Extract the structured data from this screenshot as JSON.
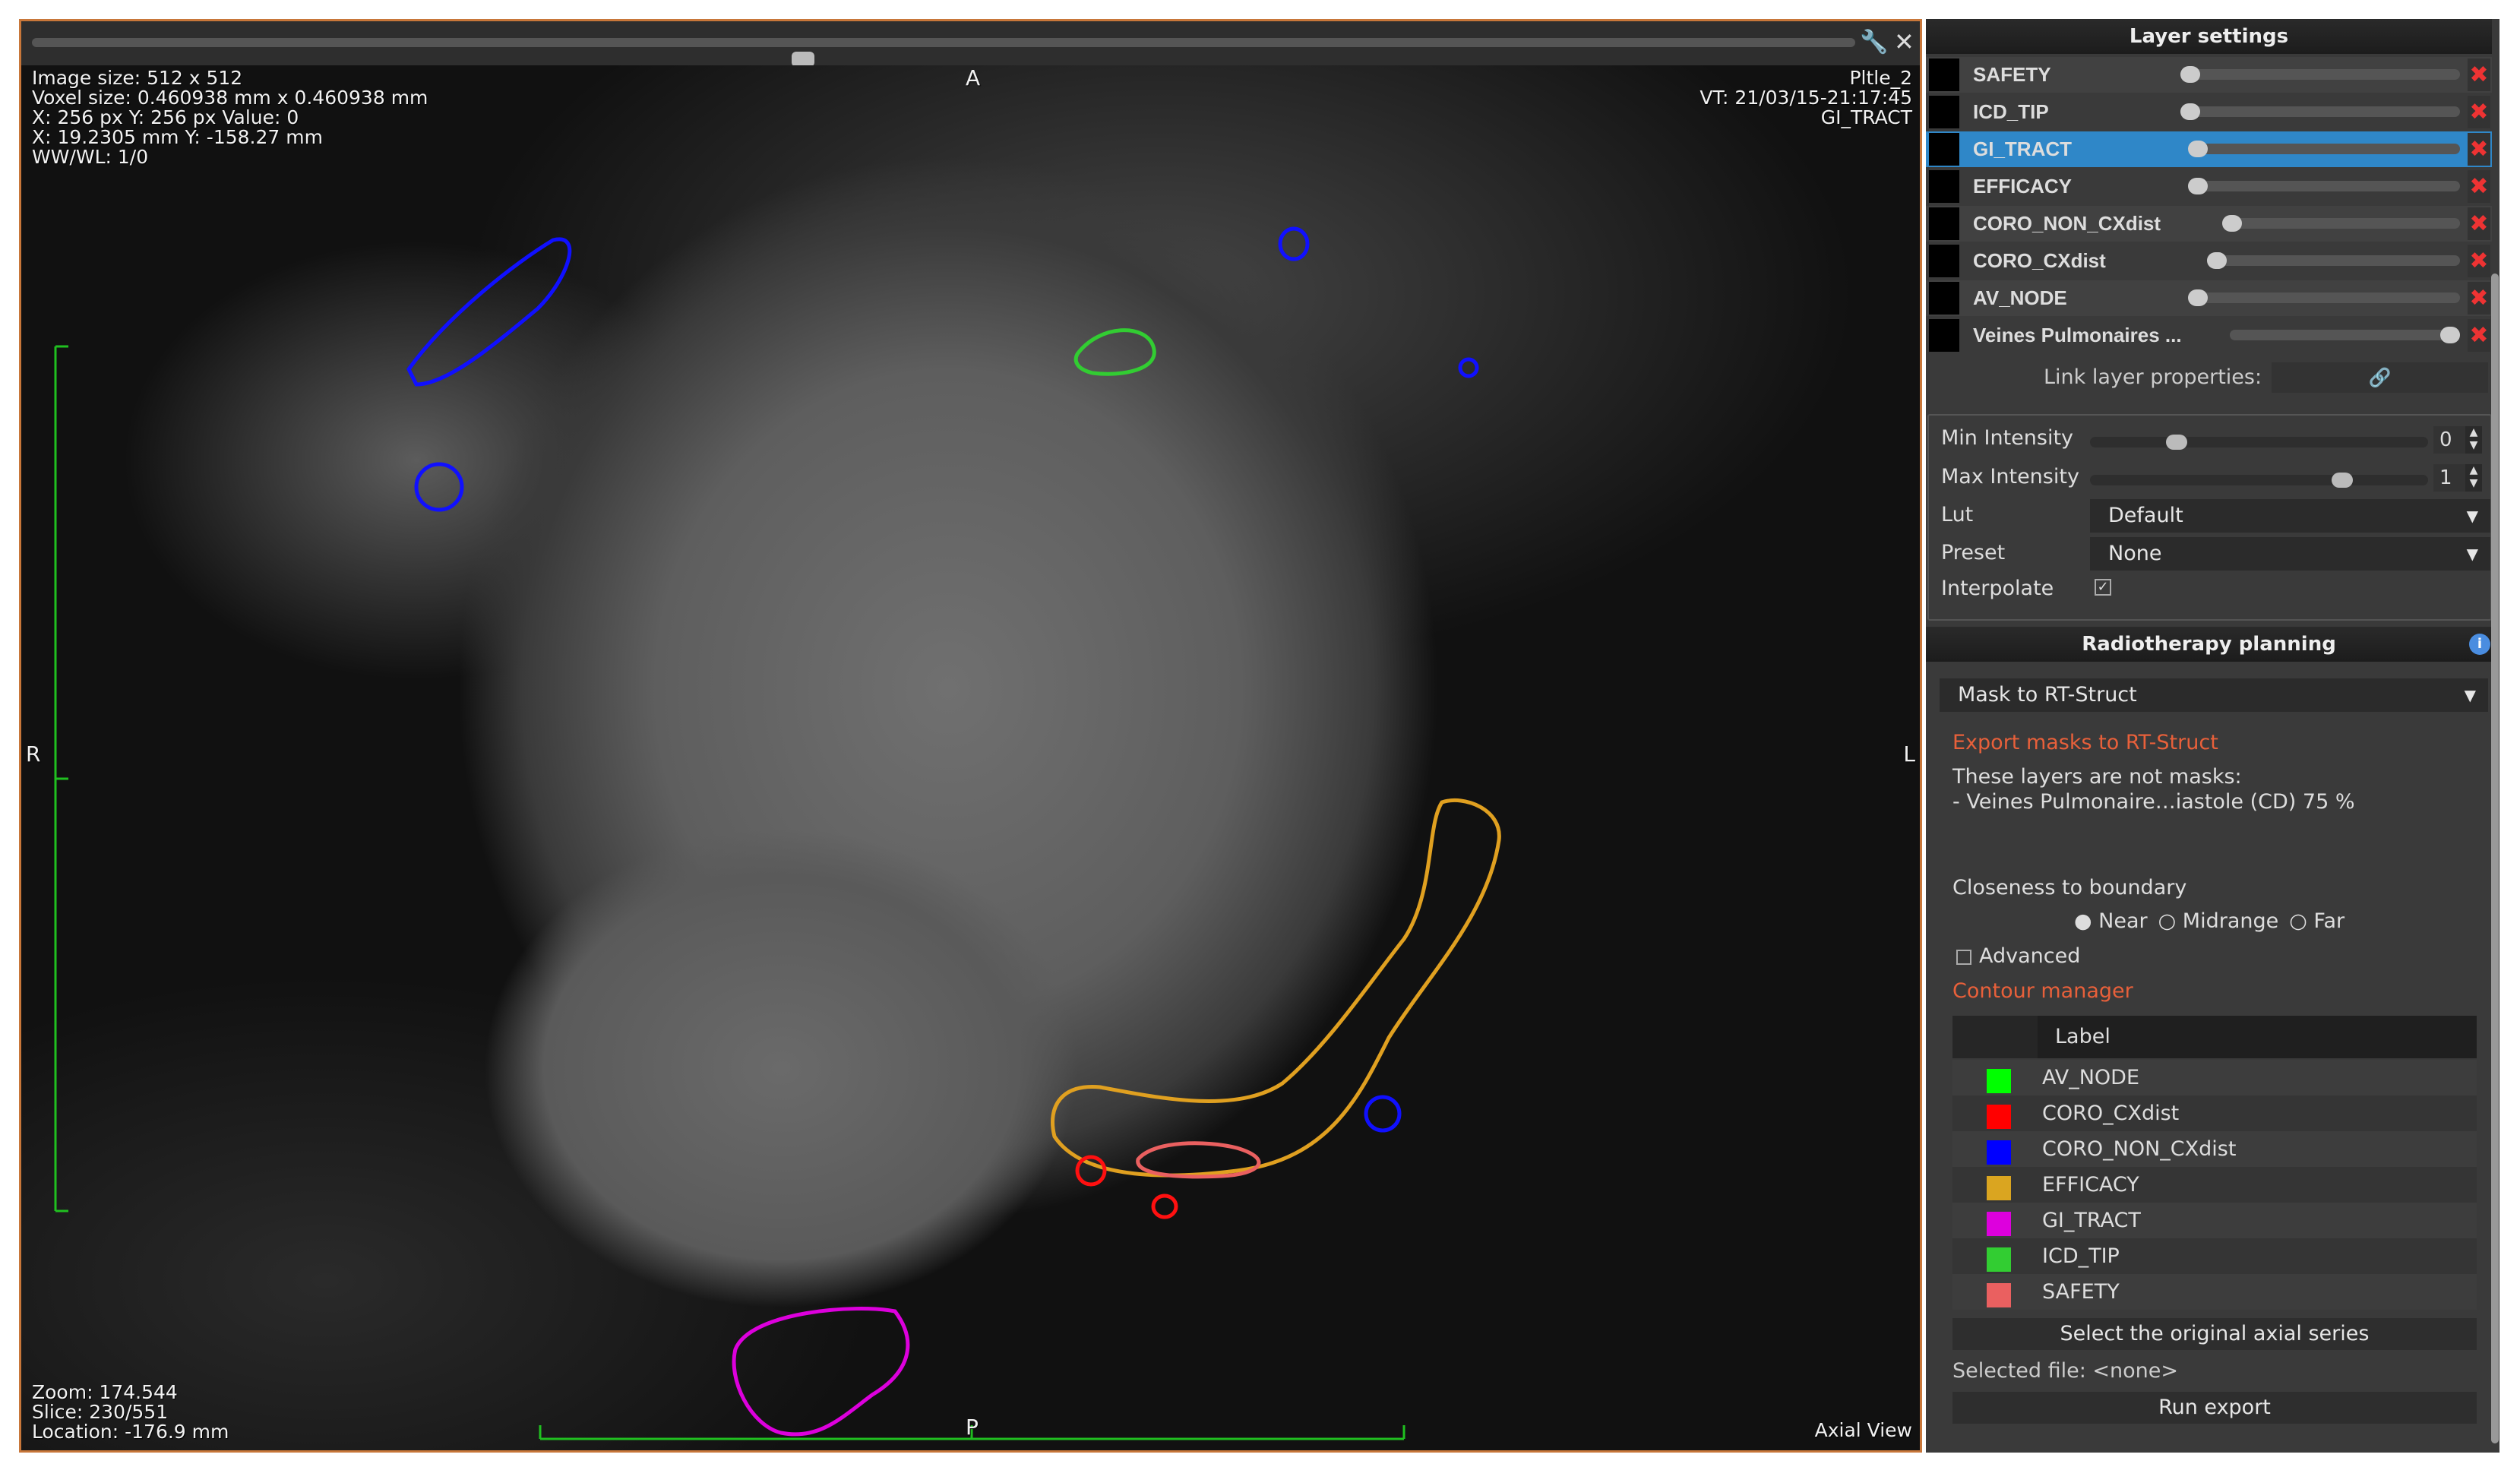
{
  "viewer": {
    "info_top_left": [
      "Image size: 512 x 512",
      "Voxel size: 0.460938 mm x 0.460938 mm",
      "X: 256 px Y: 256 px Value: 0",
      "X:  19.2305 mm Y: -158.27 mm",
      "WW/WL: 1/0"
    ],
    "info_top_right": [
      "Pltle_2",
      "VT: 21/03/15-21:17:45",
      "GI_TRACT"
    ],
    "info_bottom_left": [
      "Zoom: 174.544",
      "Slice: 230/551",
      "Location: -176.9 mm"
    ],
    "view_name": "Axial View",
    "orient": {
      "top": "A",
      "bottom": "P",
      "left": "R",
      "right": "L"
    },
    "slice_slider_fraction": 0.42
  },
  "layer_settings": {
    "title": "Layer settings",
    "layers": [
      {
        "name": "SAFETY",
        "opacity": 0.0
      },
      {
        "name": "ICD_TIP",
        "opacity": 0.0
      },
      {
        "name": "GI_TRACT",
        "opacity": 0.0,
        "selected": true
      },
      {
        "name": "EFFICACY",
        "opacity": 0.0
      },
      {
        "name": "CORO_NON_CXdist",
        "opacity": 0.0
      },
      {
        "name": "CORO_CXdist",
        "opacity": 0.0
      },
      {
        "name": "AV_NODE",
        "opacity": 0.0
      },
      {
        "name": "Veines Pulmonaires ...",
        "opacity": 1.0
      }
    ],
    "link_label": "Link layer properties:",
    "min_label": "Min Intensity",
    "min_value": "0",
    "max_label": "Max Intensity",
    "max_value": "1",
    "lut_label": "Lut",
    "lut_value": "Default",
    "preset_label": "Preset",
    "preset_value": "None",
    "interpolate_label": "Interpolate",
    "interpolate_checked": true
  },
  "rt": {
    "title": "Radiotherapy planning",
    "mode": "Mask to RT-Struct",
    "export_title": "Export masks to RT-Struct",
    "not_masks": "These layers are not masks:",
    "not_masks_item": "- Veines Pulmonaire…iastole (CD) 75 %",
    "closeness_label": "Closeness to boundary",
    "radios": [
      "Near",
      "Midrange",
      "Far"
    ],
    "selected_radio": "Near",
    "advanced_label": "Advanced",
    "contour_title": "Contour manager",
    "table_header": "Label",
    "contours": [
      {
        "label": "AV_NODE",
        "color": "#00ff00"
      },
      {
        "label": "CORO_CXdist",
        "color": "#ff0000"
      },
      {
        "label": "CORO_NON_CXdist",
        "color": "#0000ff"
      },
      {
        "label": "EFFICACY",
        "color": "#daa520"
      },
      {
        "label": "GI_TRACT",
        "color": "#dd00dd"
      },
      {
        "label": "ICD_TIP",
        "color": "#32cd32"
      },
      {
        "label": "SAFETY",
        "color": "#ea6060"
      }
    ],
    "select_series_btn": "Select the original axial series",
    "selected_file_label": "Selected file:  <none>",
    "run_export_btn": "Run export"
  }
}
